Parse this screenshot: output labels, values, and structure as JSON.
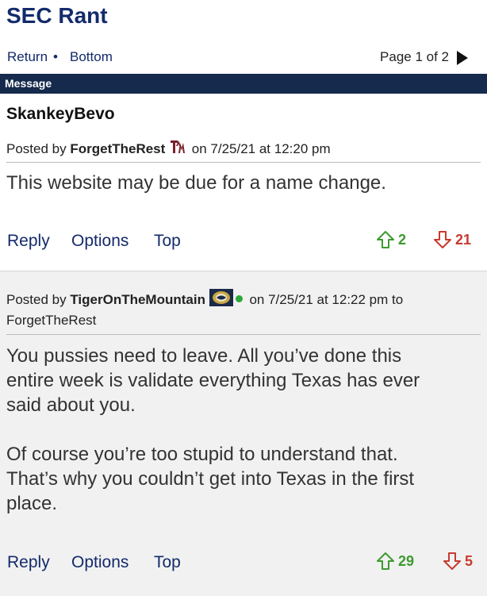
{
  "board": {
    "title": "SEC Rant"
  },
  "nav": {
    "return_label": "Return",
    "separator": "•",
    "bottom_label": "Bottom",
    "page_info": "Page 1 of 2"
  },
  "message_bar": {
    "label": "Message"
  },
  "posts": [
    {
      "subject": "SkankeyBevo",
      "posted_by_prefix": "Posted by",
      "author": "ForgetTheRest",
      "badge": "tamu-icon",
      "date_text": "on 7/25/21 at 12:20 pm",
      "body": [
        "This website may be due for a name change."
      ],
      "actions": {
        "reply": "Reply",
        "options": "Options",
        "top": "Top"
      },
      "upvotes": "2",
      "downvotes": "21"
    },
    {
      "posted_by_prefix": "Posted by",
      "author": "TigerOnTheMountain",
      "badge": "navy-insignia-icon",
      "date_text": "on 7/25/21 at 12:22 pm to",
      "reply_to": "ForgetTheRest",
      "body": [
        "You pussies need to leave. All you’ve done this",
        "entire week is validate everything Texas has ever",
        "said about you.",
        "Of course you’re too stupid to understand that.",
        "That’s why you couldn’t get into Texas in the first",
        "place."
      ],
      "actions": {
        "reply": "Reply",
        "options": "Options",
        "top": "Top"
      },
      "upvotes": "29",
      "downvotes": "5"
    }
  ],
  "colors": {
    "brand": "#132a6b",
    "bar": "#152a4d",
    "upvote": "#3d9a2f",
    "downvote": "#c83a2e"
  }
}
